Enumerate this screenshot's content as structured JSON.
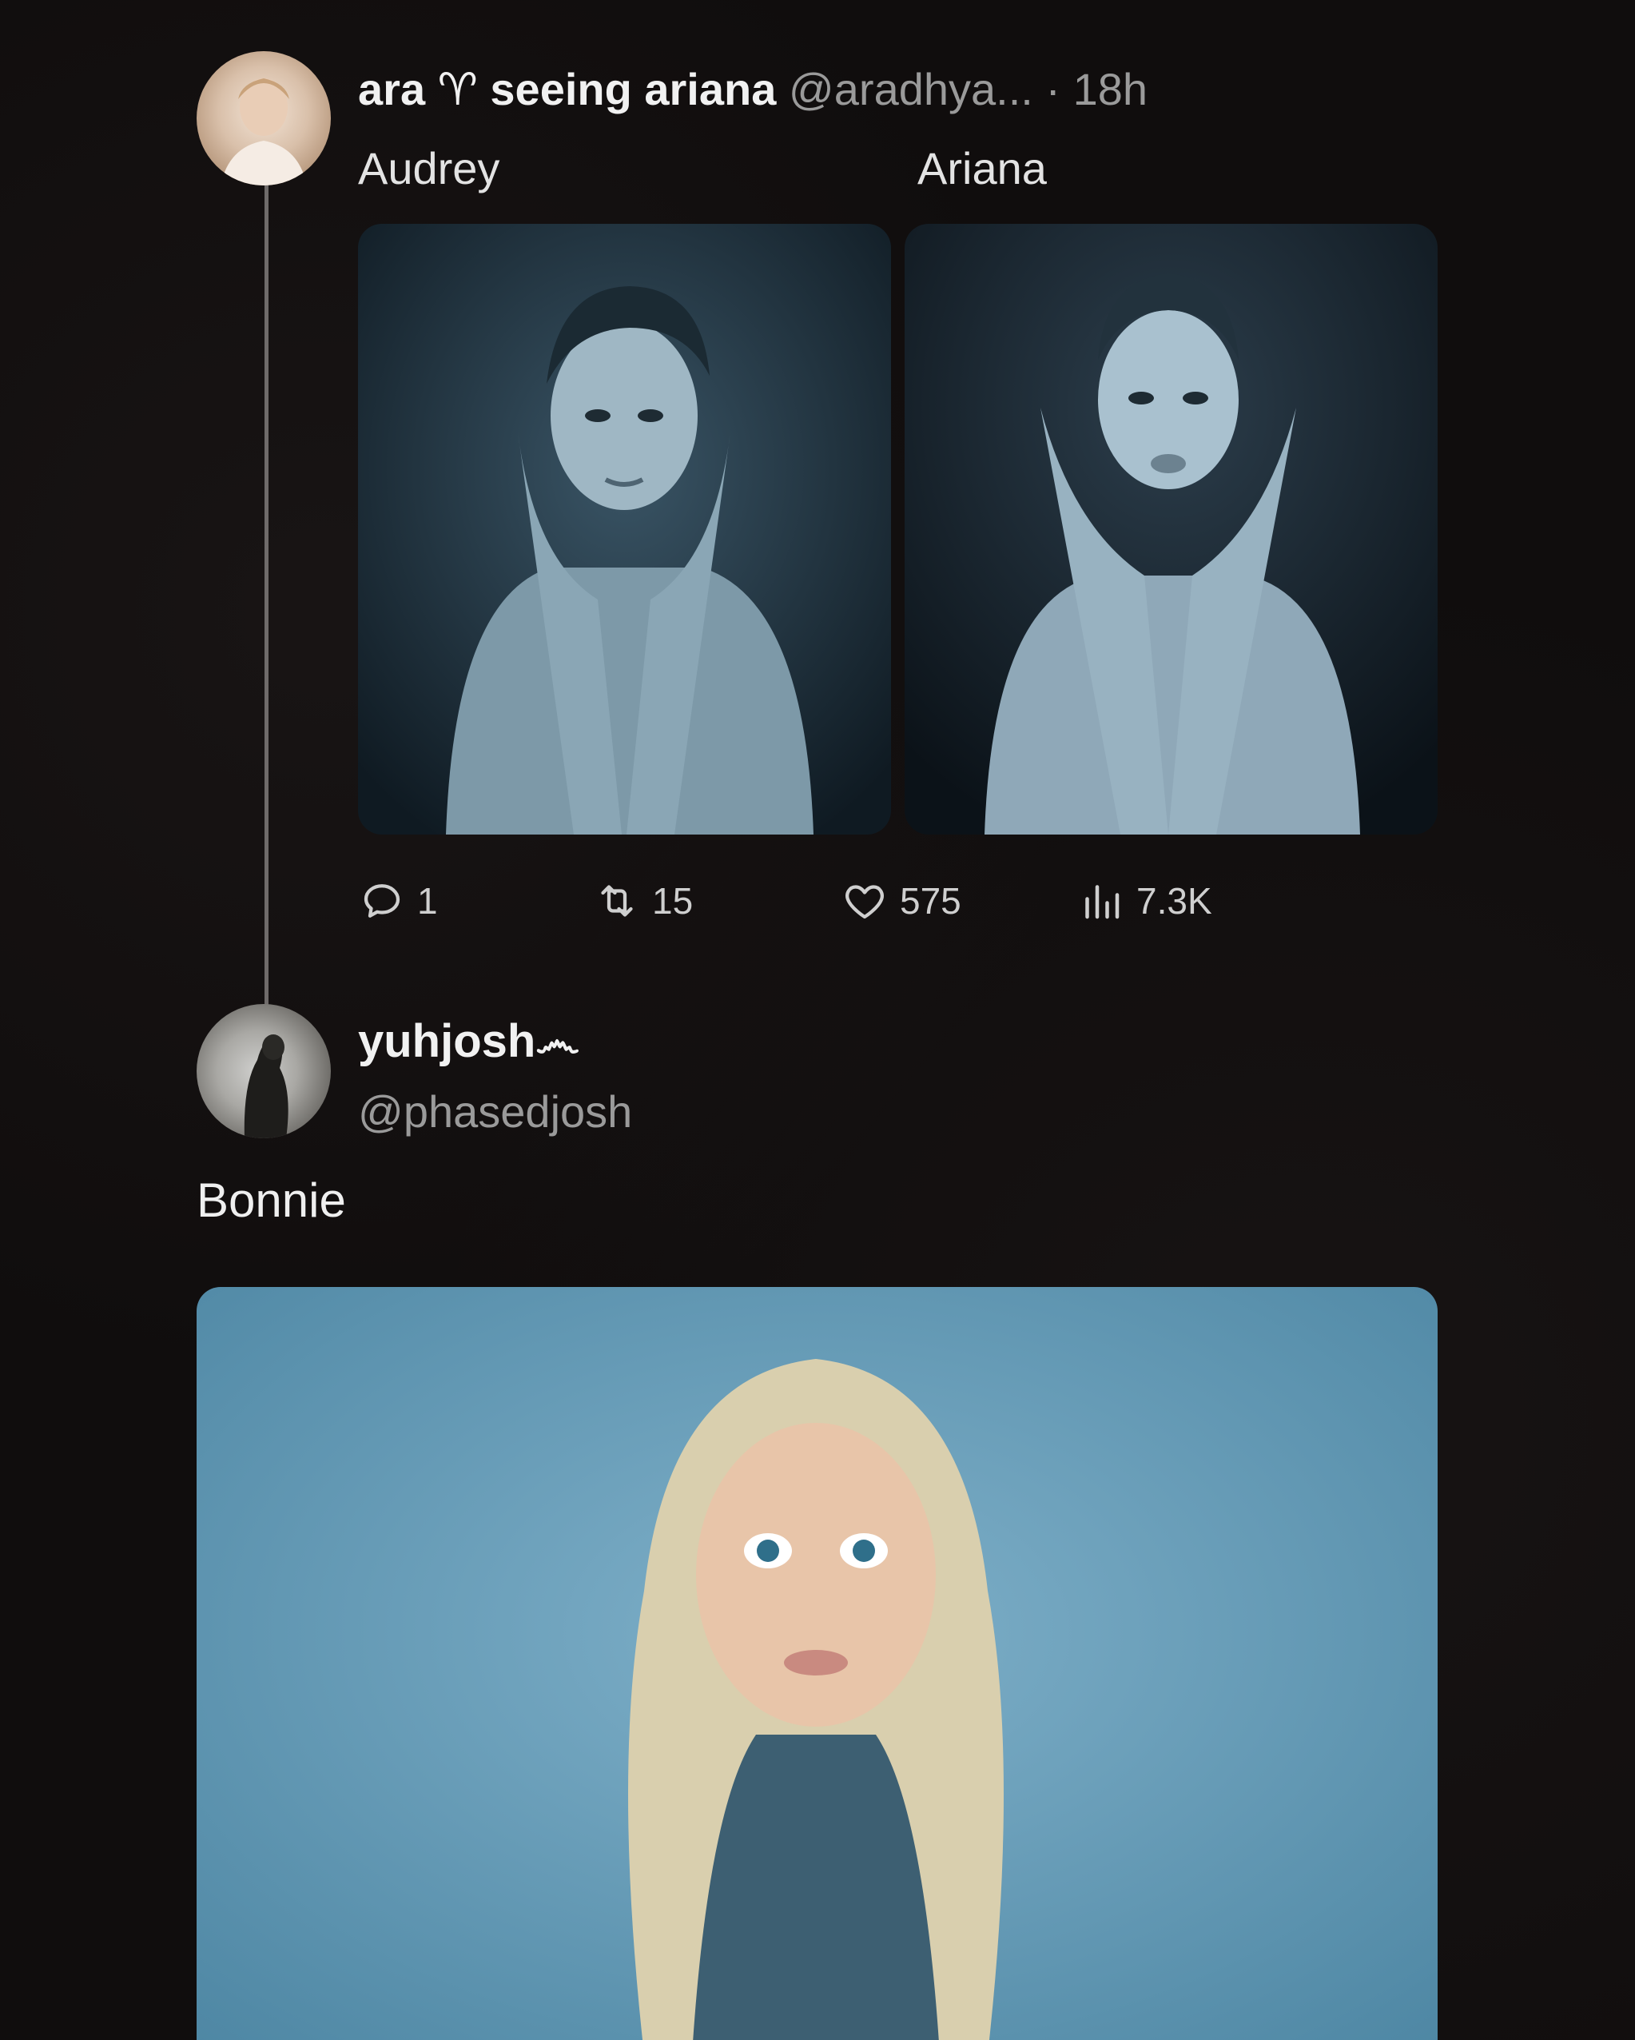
{
  "tweet": {
    "display_name": "ara ♈ seeing ariana",
    "handle_time": "@aradhya... · 18h",
    "caption_left": "Audrey",
    "caption_right": "Ariana",
    "images": [
      {
        "alt": "Audrey"
      },
      {
        "alt": "Ariana"
      }
    ],
    "stats": {
      "replies": "1",
      "retweets": "15",
      "likes": "575",
      "views": "7.3K"
    }
  },
  "reply": {
    "display_name": "yuhjosh෴",
    "handle": "@phasedjosh",
    "text": "Bonnie"
  },
  "colors": {
    "background": "#100d0d",
    "text": "#e7e9ea",
    "muted": "#9a9a9a",
    "thread_line": "#6f6b6a"
  }
}
